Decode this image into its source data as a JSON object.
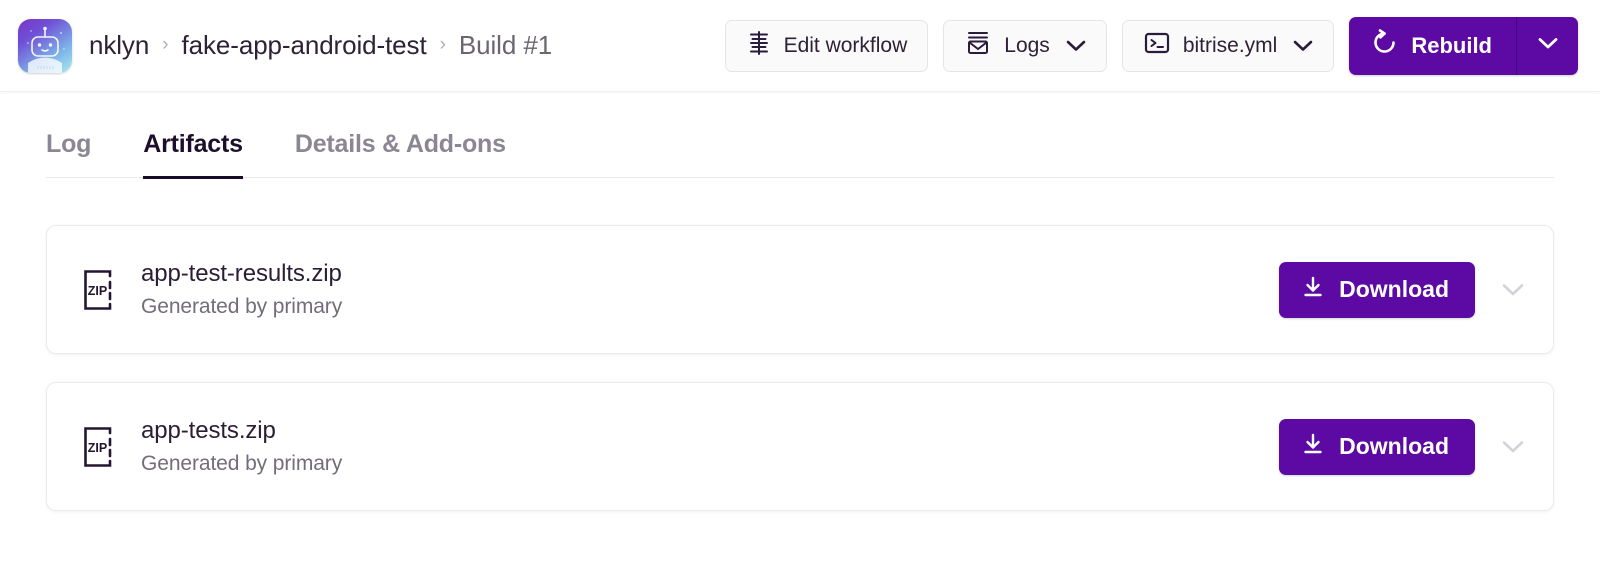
{
  "header": {
    "logo_icon": "bitrise-robot-logo-icon",
    "breadcrumb": {
      "separator": "›",
      "items": [
        {
          "label": "nklyn",
          "muted": false
        },
        {
          "label": "fake-app-android-test",
          "muted": false
        },
        {
          "label": "Build #1",
          "muted": true
        }
      ]
    },
    "toolbar": {
      "edit_workflow": {
        "label": "Edit workflow",
        "icon": "workflow-stack-icon"
      },
      "logs": {
        "label": "Logs",
        "icon": "logs-document-icon",
        "chevron": "chevron-down-icon"
      },
      "bitrise_yml": {
        "label": "bitrise.yml",
        "icon": "terminal-icon",
        "chevron": "chevron-down-icon"
      },
      "rebuild": {
        "label": "Rebuild",
        "icon": "rotate-refresh-icon",
        "chevron": "chevron-down-icon"
      }
    }
  },
  "tabs": [
    {
      "label": "Log",
      "active": false
    },
    {
      "label": "Artifacts",
      "active": true
    },
    {
      "label": "Details & Add-ons",
      "active": false
    }
  ],
  "artifacts": [
    {
      "icon": "zip-file-icon",
      "icon_label": "ZIP",
      "name": "app-test-results.zip",
      "generated_by": "Generated by primary",
      "download_label": "Download"
    },
    {
      "icon": "zip-file-icon",
      "icon_label": "ZIP",
      "name": "app-tests.zip",
      "generated_by": "Generated by primary",
      "download_label": "Download"
    }
  ],
  "colors": {
    "brand_purple": "#5C0AA3",
    "text_dark": "#2A1E35",
    "text_muted": "#736D7B",
    "tab_active": "#190A28",
    "border": "#ECEAEF"
  }
}
